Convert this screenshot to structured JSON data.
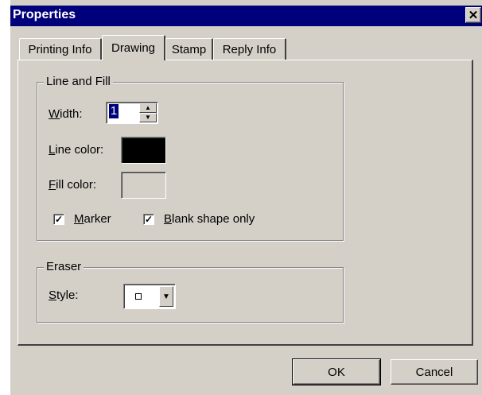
{
  "window": {
    "title": "Properties",
    "close_glyph": "✕"
  },
  "tabs": [
    {
      "label": "Printing Info",
      "active": false
    },
    {
      "label": "Drawing",
      "active": true
    },
    {
      "label": "Stamp",
      "active": false
    },
    {
      "label": "Reply Info",
      "active": false
    }
  ],
  "line_and_fill": {
    "group_label": "Line and Fill",
    "width_label_u": "W",
    "width_label_rest": "idth:",
    "width_value": "1",
    "line_color_label_u": "L",
    "line_color_label_rest": "ine color:",
    "line_color": "#000000",
    "fill_color_label_u": "F",
    "fill_color_label_rest": "ill color:",
    "fill_color": "#d4d0c8",
    "marker_label_u": "M",
    "marker_label_rest": "arker",
    "marker_checked": true,
    "blank_shape_label_u": "B",
    "blank_shape_label_rest": "lank shape only",
    "blank_shape_checked": true
  },
  "eraser": {
    "group_label": "Eraser",
    "style_label_u": "S",
    "style_label_rest": "tyle:"
  },
  "buttons": {
    "ok": "OK",
    "cancel": "Cancel"
  },
  "colors": {
    "title_bar": "#00007b",
    "dialog_face": "#d4d0c8"
  }
}
